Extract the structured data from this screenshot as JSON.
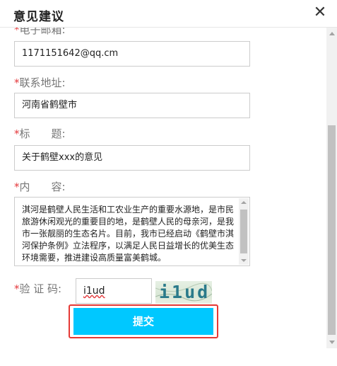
{
  "dialog": {
    "title": "意见建议",
    "close_glyph": "✕"
  },
  "form": {
    "email": {
      "label": "电子邮箱:",
      "value": "1171151642@qq.cm"
    },
    "address": {
      "label": "联系地址:",
      "value": "河南省鹤壁市"
    },
    "subject": {
      "label_a": "标",
      "label_b": "题:",
      "value": "关于鹤壁xxx的意见"
    },
    "content": {
      "label_a": "内",
      "label_b": "容:",
      "value": "淇河是鹤壁人民生活和工农业生产的重要水源地，是市民旅游休闲观光的重要目的地，是鹤壁人民的母亲河，是我市一张靓丽的生态名片。目前，我市已经启动《鹤壁市淇河保护条例》立法程序，以满足人民日益增长的优美生态环境需要，推进建设高质量富美鹤城。"
    },
    "captcha": {
      "label": "验 证 码:",
      "value": "i1ud",
      "image_text": "i1ud"
    },
    "required_mark": "*",
    "submit_label": "提交"
  },
  "colors": {
    "accent": "#00c8ff",
    "required": "#e4393c",
    "highlight_frame": "#e53935"
  }
}
